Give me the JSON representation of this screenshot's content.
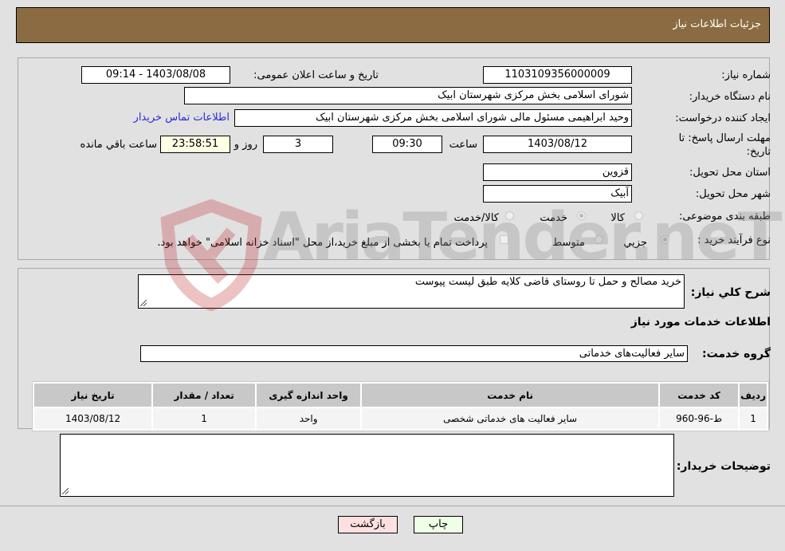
{
  "header": {
    "title": "جزئیات اطلاعات نیاز"
  },
  "form": {
    "need_number_label": "شماره نیاز:",
    "need_number": "1103109356000009",
    "announce_label": "تاریخ و ساعت اعلان عمومی:",
    "announce_value": "1403/08/08 - 09:14",
    "buyer_org_label": "نام دستگاه خریدار:",
    "buyer_org": "شورای اسلامی بخش مرکزی شهرستان ابیک",
    "creator_label": "ایجاد کننده درخواست:",
    "creator": "وحید ابراهیمی مسئول مالی شورای اسلامی بخش مرکزی شهرستان ابیک",
    "contact_link": "اطلاعات تماس خریدار",
    "deadline_label_1": "مهلت ارسال پاسخ: تا",
    "deadline_label_2": "تاریخ:",
    "deadline_date": "1403/08/12",
    "time_label": "ساعت",
    "deadline_time": "09:30",
    "days_value": "3",
    "days_label": "روز و",
    "remaining_time": "23:58:51",
    "remaining_label": "ساعت باقي مانده",
    "province_label": "استان محل تحویل:",
    "province": "قزوین",
    "city_label": "شهر محل تحویل:",
    "city": "آبیک",
    "category_label": "طبقه بندی موضوعی:",
    "category_options": [
      {
        "label": "کالا",
        "selected": false
      },
      {
        "label": "خدمت",
        "selected": true
      },
      {
        "label": "کالا/خدمت",
        "selected": false
      }
    ],
    "process_label": "نوع فرآیند خرید :",
    "process_options": [
      {
        "label": "جزيي",
        "selected": true
      },
      {
        "label": "متوسط",
        "selected": false
      }
    ],
    "treasury_note": "پرداخت تمام یا بخشی از مبلغ خرید،از محل \"اسناد خزانه اسلامی\" خواهد بود.",
    "treasury_checked": false
  },
  "details": {
    "summary_label": "شرح کلي نیاز:",
    "summary": "خرید مصالح و حمل تا روستای قاضی کلایه طبق لیست پیوست",
    "services_title": "اطلاعات خدمات مورد نیاز",
    "service_group_label": "گروه خدمت:",
    "service_group": "سایر فعالیت‌های خدماتی",
    "table": {
      "headers": [
        "ردیف",
        "کد خدمت",
        "نام خدمت",
        "واحد اندازه گیری",
        "تعداد / مقدار",
        "تاریخ نیاز"
      ],
      "rows": [
        [
          "1",
          "ط-96-960",
          "سایر فعالیت های خدماتی شخصی",
          "واحد",
          "1",
          "1403/08/12"
        ]
      ]
    },
    "buyer_notes_label": "توضیحات خریدار:",
    "buyer_notes": ""
  },
  "buttons": {
    "print": "چاپ",
    "back": "بازگشت"
  },
  "watermark": {
    "text": "AriaTender.neT"
  },
  "colors": {
    "header": "#8b6c42",
    "print_bg": "#efffe6",
    "back_bg": "#ffe0e0",
    "link": "#2a2ad8"
  }
}
